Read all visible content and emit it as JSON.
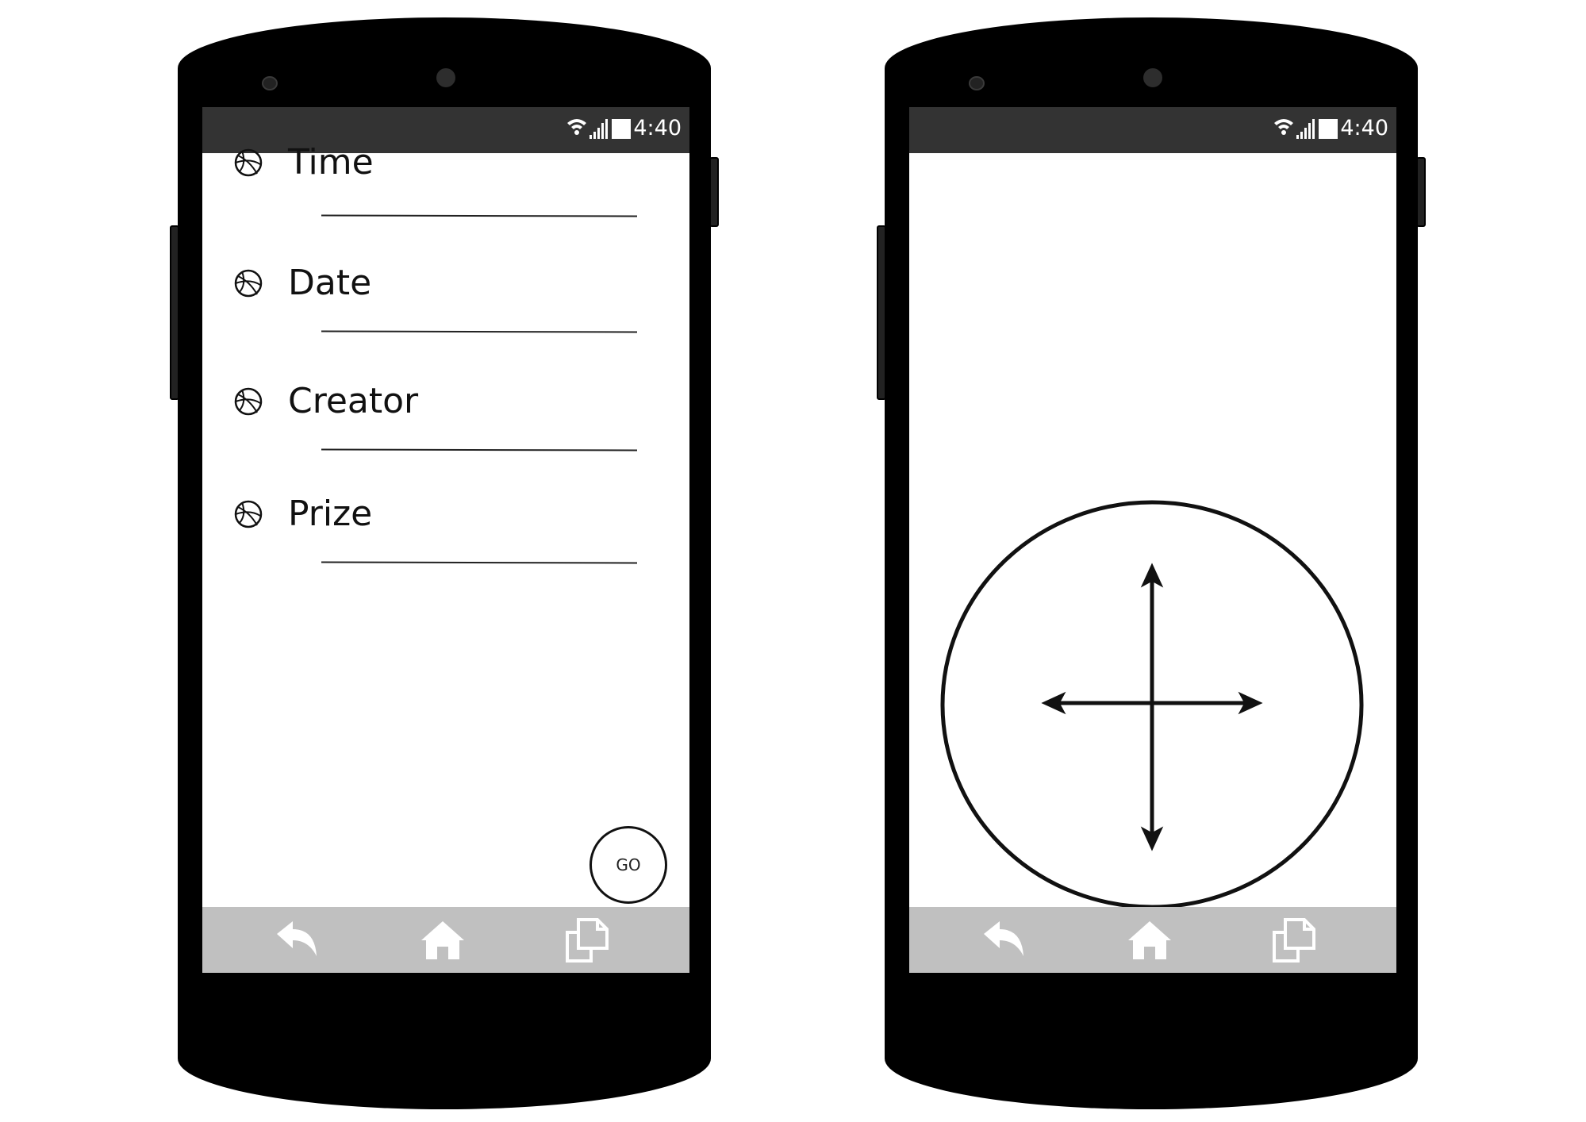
{
  "screens": {
    "left": {
      "status_bar": {
        "time": "4:40",
        "icons": [
          "wifi-icon",
          "signal-icon",
          "battery-icon"
        ]
      },
      "fields": [
        {
          "label": "Time",
          "icon": "dribbble-ball-icon"
        },
        {
          "label": "Date",
          "icon": "dribbble-ball-icon"
        },
        {
          "label": "Creator",
          "icon": "dribbble-ball-icon"
        },
        {
          "label": "Prize",
          "icon": "dribbble-ball-icon"
        }
      ],
      "go_button_label": "GO",
      "nav_bar": {
        "icons": [
          "back-icon",
          "home-icon",
          "recents-icon"
        ]
      }
    },
    "right": {
      "status_bar": {
        "time": "4:40",
        "icons": [
          "wifi-icon",
          "signal-icon",
          "battery-icon"
        ]
      },
      "joystick": {
        "icon": "four-way-arrow-icon"
      },
      "nav_bar": {
        "icons": [
          "back-icon",
          "home-icon",
          "recents-icon"
        ]
      }
    }
  },
  "colors": {
    "device_body": "#000000",
    "status_bar": "#333333",
    "nav_bar": "#c0c0c0",
    "screen_background": "#ffffff",
    "ink": "#111111"
  }
}
